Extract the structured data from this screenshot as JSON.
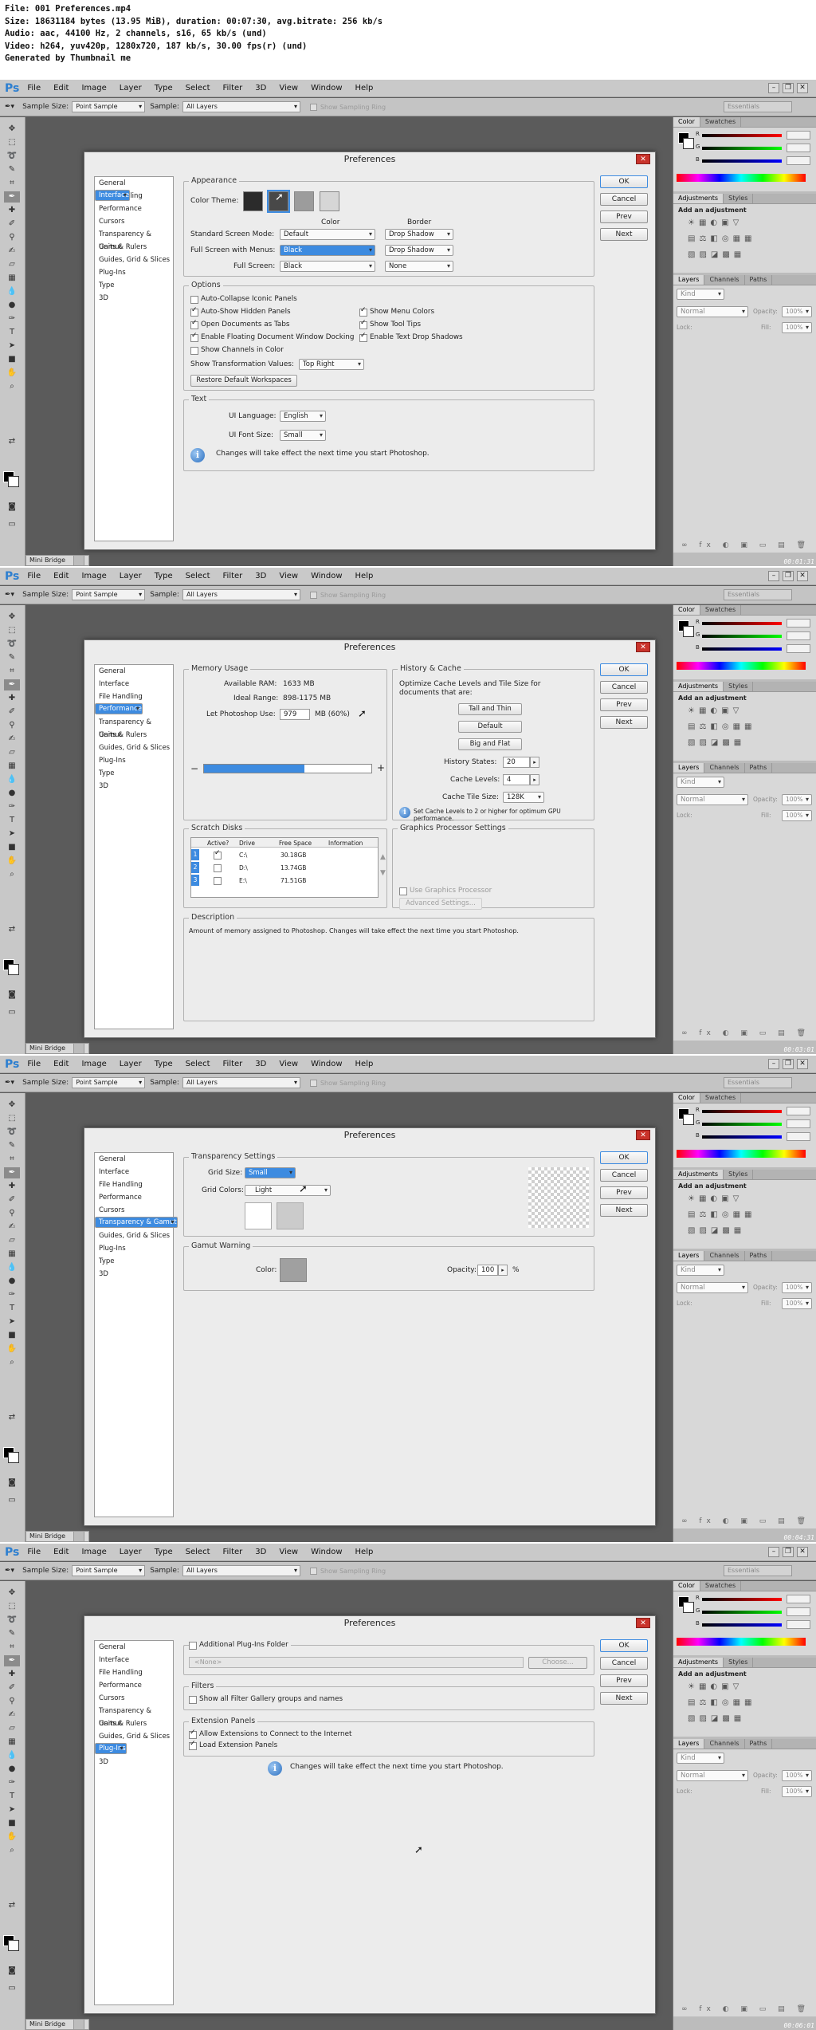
{
  "header": {
    "lines": [
      "File: 001 Preferences.mp4",
      "Size: 18631184 bytes (13.95 MiB), duration: 00:07:30, avg.bitrate: 256 kb/s",
      "Audio: aac, 44100 Hz, 2 channels, s16, 65 kb/s (und)",
      "Video: h264, yuv420p, 1280x720, 187 kb/s, 30.00 fps(r) (und)",
      "Generated by Thumbnail me"
    ]
  },
  "app": {
    "logo": "Ps",
    "menu": [
      "File",
      "Edit",
      "Image",
      "Layer",
      "Type",
      "Select",
      "Filter",
      "3D",
      "View",
      "Window",
      "Help"
    ],
    "options": {
      "sample_size_label": "Sample Size:",
      "sample_size_value": "Point Sample",
      "sample_label": "Sample:",
      "sample_value": "All Layers",
      "show_ring": "Show Sampling Ring",
      "workspace": "Essentials"
    },
    "panels": {
      "color_tabs": [
        "Color",
        "Swatches"
      ],
      "color_channels": [
        "R",
        "G",
        "B"
      ],
      "adjust_tabs": [
        "Adjustments",
        "Styles"
      ],
      "adjust_label": "Add an adjustment",
      "layer_tabs": [
        "Layers",
        "Channels",
        "Paths"
      ],
      "kind_value": "Kind",
      "blend_value": "Normal",
      "opacity_label": "Opacity:",
      "opacity_value": "100%",
      "lock_label": "Lock:",
      "fill_label": "Fill:",
      "fill_value": "100%"
    },
    "bottom_tab": "Mini Bridge",
    "timestamps": [
      "00:01:31",
      "00:03:01",
      "00:04:31",
      "00:06:01"
    ]
  },
  "dialog": {
    "title": "Preferences",
    "close": "✕",
    "buttons": {
      "ok": "OK",
      "cancel": "Cancel",
      "prev": "Prev",
      "next": "Next"
    },
    "categories": [
      "General",
      "Interface",
      "File Handling",
      "Performance",
      "Cursors",
      "Transparency & Gamut",
      "Units & Rulers",
      "Guides, Grid & Slices",
      "Plug-Ins",
      "Type",
      "3D"
    ],
    "selected": [
      "Interface",
      "Performance",
      "Transparency & Gamut",
      "Plug-Ins"
    ]
  },
  "interface": {
    "appearance_title": "Appearance",
    "color_theme": "Color Theme:",
    "col_color": "Color",
    "col_border": "Border",
    "rows": [
      {
        "label": "Standard Screen Mode:",
        "color": "Default",
        "border": "Drop Shadow"
      },
      {
        "label": "Full Screen with Menus:",
        "color": "Black",
        "border": "Drop Shadow"
      },
      {
        "label": "Full Screen:",
        "color": "Black",
        "border": "None"
      }
    ],
    "options_title": "Options",
    "opts_left": [
      "Auto-Collapse Iconic Panels",
      "Auto-Show Hidden Panels",
      "Open Documents as Tabs",
      "Enable Floating Document Window Docking",
      "Show Channels in Color"
    ],
    "opts_left_checked": [
      false,
      true,
      true,
      true,
      false
    ],
    "opts_right": [
      "Show Menu Colors",
      "Show Tool Tips",
      "Enable Text Drop Shadows"
    ],
    "opts_right_checked": [
      true,
      true,
      true
    ],
    "transform_label": "Show Transformation Values:",
    "transform_value": "Top Right",
    "restore": "Restore Default Workspaces",
    "text_title": "Text",
    "ui_language_label": "UI Language:",
    "ui_language": "English",
    "ui_font_label": "UI Font Size:",
    "ui_font": "Small",
    "note": "Changes will take effect the next time you start Photoshop."
  },
  "performance": {
    "memory_title": "Memory Usage",
    "ram_label": "Available RAM:",
    "ram": "1633 MB",
    "range_label": "Ideal Range:",
    "range": "898-1175 MB",
    "let_label": "Let Photoshop Use:",
    "let_value": "979",
    "let_unit": "MB (60%)",
    "usage_fraction": 0.6,
    "minus": "−",
    "plus": "+",
    "history_title": "History & Cache",
    "history_desc": "Optimize Cache Levels and Tile Size for documents that are:",
    "presets": [
      "Tall and Thin",
      "Default",
      "Big and Flat"
    ],
    "states_label": "History States:",
    "states": "20",
    "levels_label": "Cache Levels:",
    "levels": "4",
    "tile_label": "Cache Tile Size:",
    "tile": "128K",
    "cache_note": "Set Cache Levels to 2 or higher for optimum GPU performance.",
    "scratch_title": "Scratch Disks",
    "scratch_cols": [
      "Active?",
      "Drive",
      "Free Space",
      "Information"
    ],
    "scratch_rows": [
      {
        "n": "1",
        "active": true,
        "drive": "C:\\",
        "free": "30.18GB"
      },
      {
        "n": "2",
        "active": false,
        "drive": "D:\\",
        "free": "13.74GB"
      },
      {
        "n": "3",
        "active": false,
        "drive": "E:\\",
        "free": "71.51GB"
      }
    ],
    "gpu_title": "Graphics Processor Settings",
    "gpu_use": "Use Graphics Processor",
    "gpu_adv": "Advanced Settings...",
    "desc_title": "Description",
    "desc": "Amount of memory assigned to Photoshop. Changes will take effect the next time you start Photoshop."
  },
  "transparency": {
    "title": "Transparency Settings",
    "grid_size_label": "Grid Size:",
    "grid_size": "Small",
    "grid_colors_label": "Grid Colors:",
    "grid_colors": "Light",
    "gamut_title": "Gamut Warning",
    "color_label": "Color:",
    "opacity_label": "Opacity:",
    "opacity": "100",
    "pct": "%"
  },
  "plugins": {
    "additional": "Additional Plug-Ins Folder",
    "path_placeholder": "<None>",
    "choose": "Choose...",
    "filters_title": "Filters",
    "filters_opt": "Show all Filter Gallery groups and names",
    "ext_title": "Extension Panels",
    "ext_opts": [
      "Allow Extensions to Connect to the Internet",
      "Load Extension Panels"
    ],
    "note": "Changes will take effect the next time you start Photoshop."
  },
  "colors": {
    "accent": "#3d8be0",
    "chrome": "#5b5b5b",
    "close_red": "#c9332b",
    "gamut_gray": "#a0a0a0"
  }
}
